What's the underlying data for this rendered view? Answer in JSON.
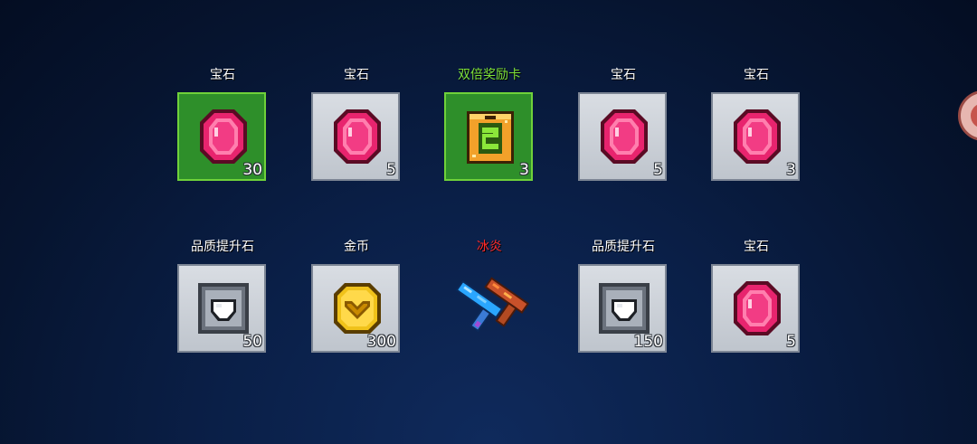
{
  "rewards": [
    {
      "label": "宝石",
      "label_color": "white",
      "quantity": "30",
      "icon": "gem-icon",
      "slot": "green"
    },
    {
      "label": "宝石",
      "label_color": "white",
      "quantity": "5",
      "icon": "gem-icon",
      "slot": "gray"
    },
    {
      "label": "双倍奖励卡",
      "label_color": "green",
      "quantity": "3",
      "icon": "double-reward-card-icon",
      "slot": "green"
    },
    {
      "label": "宝石",
      "label_color": "white",
      "quantity": "5",
      "icon": "gem-icon",
      "slot": "gray"
    },
    {
      "label": "宝石",
      "label_color": "white",
      "quantity": "3",
      "icon": "gem-icon",
      "slot": "gray"
    },
    {
      "label": "品质提升石",
      "label_color": "white",
      "quantity": "50",
      "icon": "quality-stone-icon",
      "slot": "gray"
    },
    {
      "label": "金币",
      "label_color": "white",
      "quantity": "300",
      "icon": "gold-coin-icon",
      "slot": "gray"
    },
    {
      "label": "冰炎",
      "label_color": "red",
      "quantity": "",
      "icon": "ice-flame-guns-icon",
      "slot": "none"
    },
    {
      "label": "品质提升石",
      "label_color": "white",
      "quantity": "150",
      "icon": "quality-stone-icon",
      "slot": "gray"
    },
    {
      "label": "宝石",
      "label_color": "white",
      "quantity": "5",
      "icon": "gem-icon",
      "slot": "gray"
    }
  ],
  "colors": {
    "background": "#0a1f47",
    "green_slot": "#2e8f2a",
    "gray_slot": "#cfd3d9",
    "gem": "#e8246e",
    "gold": "#f0c21a",
    "label_green": "#7ee03a",
    "label_red": "#ff2a2a"
  },
  "side_button_icon": "play-circle-icon"
}
